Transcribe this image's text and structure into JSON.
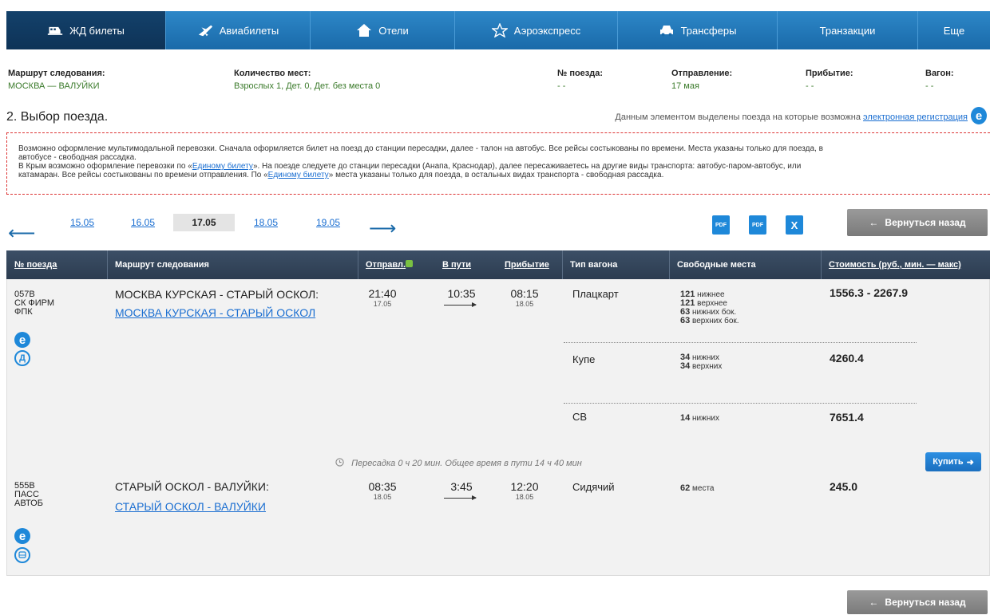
{
  "nav": {
    "items": [
      {
        "label": "ЖД билеты",
        "icon": "train-icon"
      },
      {
        "label": "Авиабилеты",
        "icon": "plane-icon"
      },
      {
        "label": "Отели",
        "icon": "house-icon"
      },
      {
        "label": "Аэроэкспресс",
        "icon": "aeroexpress-star-icon"
      },
      {
        "label": "Трансферы",
        "icon": "car-icon"
      },
      {
        "label": "Транзакции",
        "icon": ""
      },
      {
        "label": "Еще",
        "icon": ""
      }
    ]
  },
  "summary": {
    "route_label": "Маршрут следования:",
    "route_value": "МОСКВА — ВАЛУЙКИ",
    "seats_label": "Количество мест:",
    "seats_value": "Взрослых 1, Дет. 0, Дет. без места 0",
    "train_label": "№ поезда:",
    "train_value": "- -",
    "departure_label": "Отправление:",
    "departure_value": "17 мая",
    "arrival_label": "Прибытие:",
    "arrival_value": "- -",
    "car_label": "Вагон:",
    "car_value": "- -"
  },
  "step_title": "2. Выбор поезда.",
  "ereg": {
    "text": "Данным элементом выделены поезда на которые возможна",
    "link": "электронная регистрация",
    "badge": "e"
  },
  "info": {
    "line1": "Возможно оформление мультимодальной перевозки. Сначала оформляется билет на поезд до станции пересадки, далее - талон на автобус. Все рейсы состыкованы по времени. Места указаны только для поезда, в",
    "line2": "автобусе - свободная рассадка.",
    "line3_a": "В Крым возможно оформление перевозки по «",
    "line3_link": "Единому билету",
    "line3_b": "». На поезде следуете до станции пересадки (Анапа, Краснодар), далее пересаживаетесь на другие виды транспорта: автобус-паром-автобус, или",
    "line4_a": "катамаран. Все рейсы состыкованы по времени отправления. По «",
    "line4_link": "Единому билету",
    "line4_b": "» места указаны только для поезда, в остальных видах транспорта - свободная рассадка."
  },
  "dates": {
    "prev_arrow": "⟵",
    "next_arrow": "⟶",
    "items": [
      "15.05",
      "16.05",
      "17.05",
      "18.05",
      "19.05"
    ],
    "active": "17.05"
  },
  "exports": {
    "pdf1": "PDF",
    "pdf2": "PDF",
    "xls": "X"
  },
  "back_label": "Вернуться назад",
  "table": {
    "headers": {
      "train": "№ поезда",
      "route": "Маршрут следования",
      "depart": "Отправл.",
      "duration": "В пути",
      "arrive": "Прибытие",
      "car": "Тип вагона",
      "seats": "Свободные места",
      "price": "Стоимость (руб., мин. — макс)"
    },
    "trains": [
      {
        "num1": "057В",
        "num2": "СК ФИРМ",
        "num3": "ФПК",
        "route_main": "МОСКВА КУРСКАЯ - СТАРЫЙ ОСКОЛ:",
        "route_link": "МОСКВА КУРСКАЯ - СТАРЫЙ ОСКОЛ",
        "dep_time": "21:40",
        "dep_date": "17.05",
        "duration": "10:35",
        "arr_time": "08:15",
        "arr_date": "18.05",
        "badge_e": "e",
        "badge_2": "Д",
        "cars": [
          {
            "type": "Плацкарт",
            "seats": [
              [
                "121",
                "нижнее"
              ],
              [
                "121",
                "верхнее"
              ],
              [
                "63",
                "нижних бок."
              ],
              [
                "63",
                "верхних бок."
              ]
            ],
            "price": "1556.3 - 2267.9"
          },
          {
            "type": "Купе",
            "seats": [
              [
                "34",
                "нижних"
              ],
              [
                "34",
                "верхних"
              ]
            ],
            "price": "4260.4"
          },
          {
            "type": "СВ",
            "seats": [
              [
                "14",
                "нижних"
              ]
            ],
            "price": "7651.4"
          }
        ]
      },
      {
        "num1": "555В",
        "num2": "ПАСС",
        "num3": "АВТОБ",
        "route_main": "СТАРЫЙ ОСКОЛ - ВАЛУЙКИ:",
        "route_link": "СТАРЫЙ ОСКОЛ - ВАЛУЙКИ",
        "dep_time": "08:35",
        "dep_date": "18.05",
        "duration": "3:45",
        "arr_time": "12:20",
        "arr_date": "18.05",
        "badge_e": "e",
        "cars": [
          {
            "type": "Сидячий",
            "seats": [
              [
                "62",
                "места"
              ]
            ],
            "price": "245.0"
          }
        ]
      }
    ],
    "transfer": "Пересадка 0 ч 20 мин. Общее время в пути 14 ч 40 мин",
    "buy_label": "Купить"
  }
}
